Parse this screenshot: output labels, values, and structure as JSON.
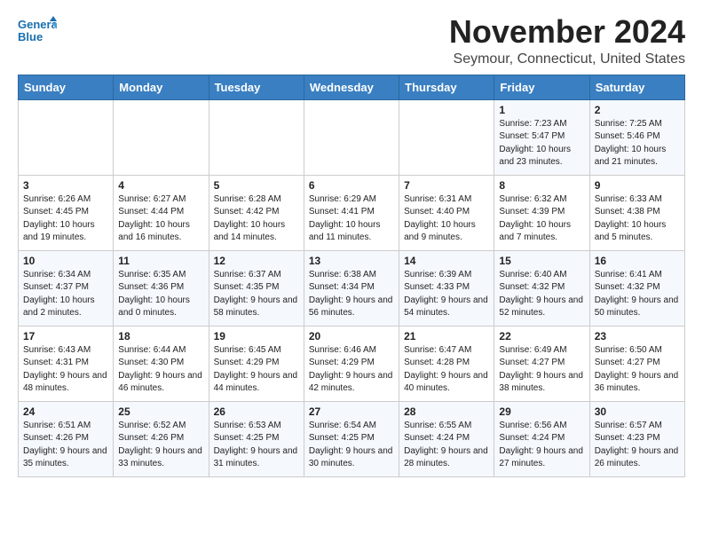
{
  "logo": {
    "text_general": "General",
    "text_blue": "Blue"
  },
  "header": {
    "month": "November 2024",
    "location": "Seymour, Connecticut, United States"
  },
  "weekdays": [
    "Sunday",
    "Monday",
    "Tuesday",
    "Wednesday",
    "Thursday",
    "Friday",
    "Saturday"
  ],
  "weeks": [
    [
      {
        "day": "",
        "info": ""
      },
      {
        "day": "",
        "info": ""
      },
      {
        "day": "",
        "info": ""
      },
      {
        "day": "",
        "info": ""
      },
      {
        "day": "",
        "info": ""
      },
      {
        "day": "1",
        "info": "Sunrise: 7:23 AM\nSunset: 5:47 PM\nDaylight: 10 hours and 23 minutes."
      },
      {
        "day": "2",
        "info": "Sunrise: 7:25 AM\nSunset: 5:46 PM\nDaylight: 10 hours and 21 minutes."
      }
    ],
    [
      {
        "day": "3",
        "info": "Sunrise: 6:26 AM\nSunset: 4:45 PM\nDaylight: 10 hours and 19 minutes."
      },
      {
        "day": "4",
        "info": "Sunrise: 6:27 AM\nSunset: 4:44 PM\nDaylight: 10 hours and 16 minutes."
      },
      {
        "day": "5",
        "info": "Sunrise: 6:28 AM\nSunset: 4:42 PM\nDaylight: 10 hours and 14 minutes."
      },
      {
        "day": "6",
        "info": "Sunrise: 6:29 AM\nSunset: 4:41 PM\nDaylight: 10 hours and 11 minutes."
      },
      {
        "day": "7",
        "info": "Sunrise: 6:31 AM\nSunset: 4:40 PM\nDaylight: 10 hours and 9 minutes."
      },
      {
        "day": "8",
        "info": "Sunrise: 6:32 AM\nSunset: 4:39 PM\nDaylight: 10 hours and 7 minutes."
      },
      {
        "day": "9",
        "info": "Sunrise: 6:33 AM\nSunset: 4:38 PM\nDaylight: 10 hours and 5 minutes."
      }
    ],
    [
      {
        "day": "10",
        "info": "Sunrise: 6:34 AM\nSunset: 4:37 PM\nDaylight: 10 hours and 2 minutes."
      },
      {
        "day": "11",
        "info": "Sunrise: 6:35 AM\nSunset: 4:36 PM\nDaylight: 10 hours and 0 minutes."
      },
      {
        "day": "12",
        "info": "Sunrise: 6:37 AM\nSunset: 4:35 PM\nDaylight: 9 hours and 58 minutes."
      },
      {
        "day": "13",
        "info": "Sunrise: 6:38 AM\nSunset: 4:34 PM\nDaylight: 9 hours and 56 minutes."
      },
      {
        "day": "14",
        "info": "Sunrise: 6:39 AM\nSunset: 4:33 PM\nDaylight: 9 hours and 54 minutes."
      },
      {
        "day": "15",
        "info": "Sunrise: 6:40 AM\nSunset: 4:32 PM\nDaylight: 9 hours and 52 minutes."
      },
      {
        "day": "16",
        "info": "Sunrise: 6:41 AM\nSunset: 4:32 PM\nDaylight: 9 hours and 50 minutes."
      }
    ],
    [
      {
        "day": "17",
        "info": "Sunrise: 6:43 AM\nSunset: 4:31 PM\nDaylight: 9 hours and 48 minutes."
      },
      {
        "day": "18",
        "info": "Sunrise: 6:44 AM\nSunset: 4:30 PM\nDaylight: 9 hours and 46 minutes."
      },
      {
        "day": "19",
        "info": "Sunrise: 6:45 AM\nSunset: 4:29 PM\nDaylight: 9 hours and 44 minutes."
      },
      {
        "day": "20",
        "info": "Sunrise: 6:46 AM\nSunset: 4:29 PM\nDaylight: 9 hours and 42 minutes."
      },
      {
        "day": "21",
        "info": "Sunrise: 6:47 AM\nSunset: 4:28 PM\nDaylight: 9 hours and 40 minutes."
      },
      {
        "day": "22",
        "info": "Sunrise: 6:49 AM\nSunset: 4:27 PM\nDaylight: 9 hours and 38 minutes."
      },
      {
        "day": "23",
        "info": "Sunrise: 6:50 AM\nSunset: 4:27 PM\nDaylight: 9 hours and 36 minutes."
      }
    ],
    [
      {
        "day": "24",
        "info": "Sunrise: 6:51 AM\nSunset: 4:26 PM\nDaylight: 9 hours and 35 minutes."
      },
      {
        "day": "25",
        "info": "Sunrise: 6:52 AM\nSunset: 4:26 PM\nDaylight: 9 hours and 33 minutes."
      },
      {
        "day": "26",
        "info": "Sunrise: 6:53 AM\nSunset: 4:25 PM\nDaylight: 9 hours and 31 minutes."
      },
      {
        "day": "27",
        "info": "Sunrise: 6:54 AM\nSunset: 4:25 PM\nDaylight: 9 hours and 30 minutes."
      },
      {
        "day": "28",
        "info": "Sunrise: 6:55 AM\nSunset: 4:24 PM\nDaylight: 9 hours and 28 minutes."
      },
      {
        "day": "29",
        "info": "Sunrise: 6:56 AM\nSunset: 4:24 PM\nDaylight: 9 hours and 27 minutes."
      },
      {
        "day": "30",
        "info": "Sunrise: 6:57 AM\nSunset: 4:23 PM\nDaylight: 9 hours and 26 minutes."
      }
    ]
  ]
}
